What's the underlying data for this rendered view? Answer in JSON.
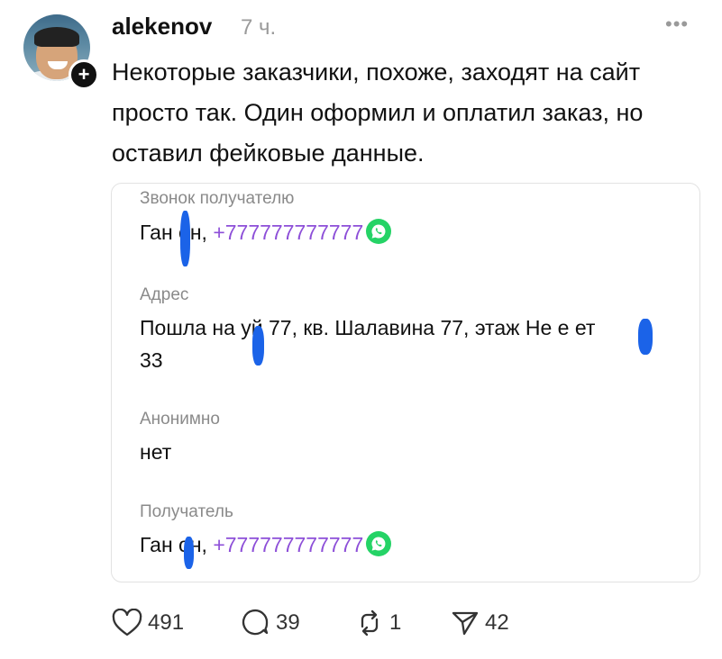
{
  "post": {
    "username": "alekenov",
    "time": "7 ч.",
    "more": "•••",
    "text": "Некоторые заказчики, похоже, заходят на сайт просто так. Один оформил и оплатил заказ, но оставил фейковые данные."
  },
  "card": {
    "call_label": "Звонок получателю",
    "call_name": "Ган  он,",
    "call_phone": "+777777777777",
    "address_label": "Адрес",
    "address_line1": "Пошла на  уй 77, кв. Шалавина 77, этаж Не е  ет",
    "address_line2": "33",
    "anon_label": "Анонимно",
    "anon_value": "нет",
    "recipient_label": "Получатель",
    "recipient_name": "Ган  он,",
    "recipient_phone": "+777777777777"
  },
  "actions": {
    "likes": "491",
    "comments": "39",
    "reposts": "1",
    "shares": "42"
  },
  "colors": {
    "phone": "#8d4fd8",
    "whatsapp": "#25d366",
    "redaction": "#1b63e8"
  }
}
